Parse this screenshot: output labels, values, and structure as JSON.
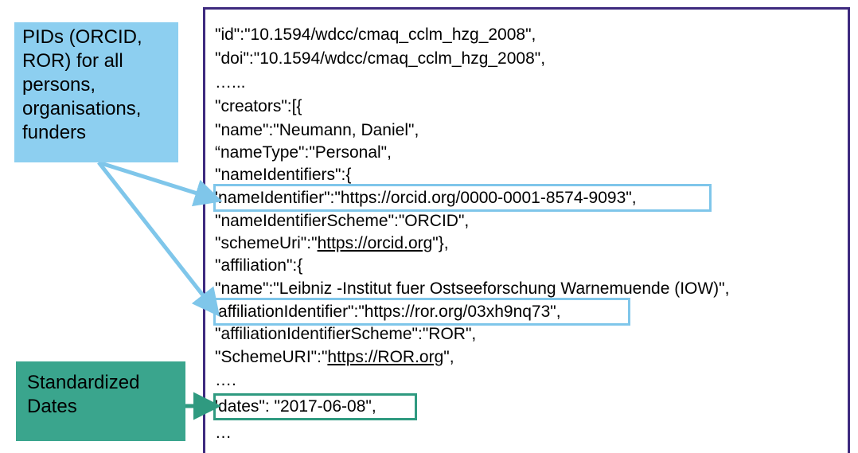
{
  "callouts": {
    "pids": "PIDs (ORCID, ROR) for all persons, organisations, funders",
    "dates": "Standardized Dates"
  },
  "colors": {
    "code_border": "#3e2a7f",
    "pid_callout": "#8dcff0",
    "pid_highlight": "#7fc6ea",
    "date_callout": "#3aa58d",
    "date_highlight": "#2f9a80"
  },
  "code": {
    "id_line": " \"id\":\"10.1594/wdcc/cmaq_cclm_hzg_2008\",",
    "doi_line": " \"doi\":\"10.1594/wdcc/cmaq_cclm_hzg_2008\",",
    "ellipsis1": "…...",
    "creators": "\"creators\":[{",
    "name": "\"name\":\"Neumann, Daniel\",",
    "nametype": "“nameType\":\"Personal\",",
    "nameidentifiers": "\"nameIdentifiers\":{",
    "nameidentifier": "'nameIdentifier\":\"https://orcid.org/0000-0001-8574-9093\",",
    "nameidentifierscheme": "\"nameIdentifierScheme\":\"ORCID\",",
    "schemeuri_prefix": "\"schemeUri\":\"",
    "schemeuri_link": "https://orcid.org",
    "schemeuri_suffix": "\"},",
    "affiliation": "\"affiliation\":{",
    "aff_name": "\"name\":\"Leibniz -Institut fuer Ostseeforschung Warnemuende (IOW)\",",
    "aff_identifier": "'affiliationIdentifier\":\"https://ror.org/03xh9nq73\",",
    "aff_identifier_scheme": "\"affiliationIdentifierScheme\":\"ROR\",",
    "scheme_uri_upper_prefix": "\"SchemeURI\":\"",
    "scheme_uri_upper_link": "https://ROR.org",
    "scheme_uri_upper_suffix": "\",",
    "ellipsis2": "….",
    "dates": "'dates\":  \"2017-06-08\",",
    "ellipsis3": "…"
  }
}
